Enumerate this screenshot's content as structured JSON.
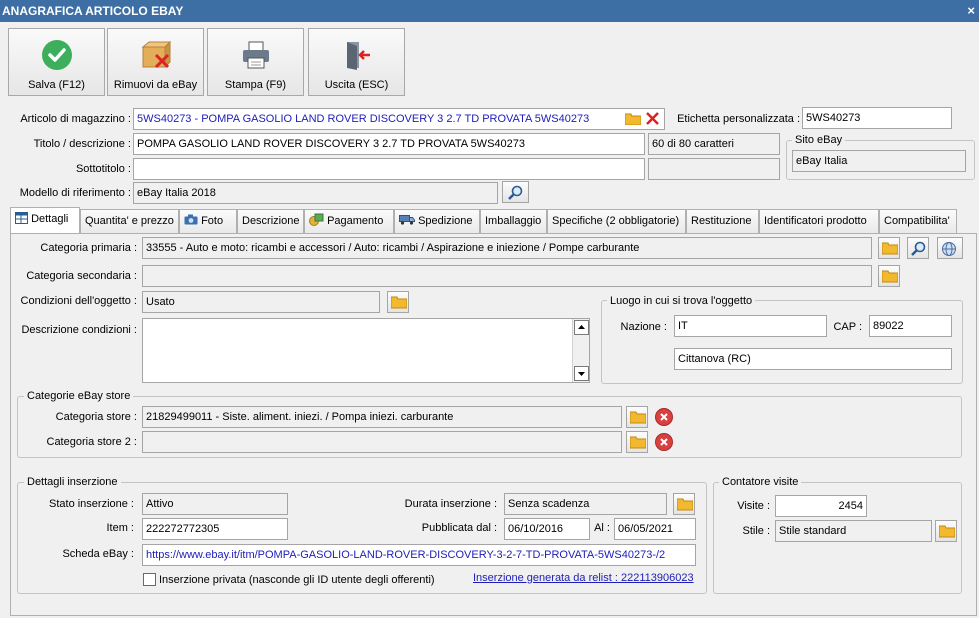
{
  "window": {
    "title": "ANAGRAFICA ARTICOLO EBAY",
    "close_glyph": "×"
  },
  "toolbar": {
    "save": "Salva (F12)",
    "remove": "Rimuovi da eBay",
    "print": "Stampa (F9)",
    "exit": "Uscita (ESC)"
  },
  "header": {
    "articolo_label": "Articolo di magazzino :",
    "articolo_value": "5WS40273 - POMPA GASOLIO LAND ROVER DISCOVERY 3 2.7 TD PROVATA 5WS40273",
    "etichetta_label": "Etichetta personalizzata :",
    "etichetta_value": "5WS40273",
    "titolo_label": "Titolo / descrizione :",
    "titolo_value": "POMPA GASOLIO LAND ROVER DISCOVERY 3 2.7 TD PROVATA 5WS40273",
    "titolo_count": "60 di 80 caratteri",
    "sottotitolo_label": "Sottotitolo :",
    "sottotitolo_value": "",
    "sito_title": "Sito eBay",
    "sito_value": "eBay Italia",
    "modello_label": "Modello di riferimento :",
    "modello_value": "eBay Italia 2018"
  },
  "tabs": [
    {
      "label": "Dettagli",
      "icon": "grid-icon"
    },
    {
      "label": "Quantita' e prezzo"
    },
    {
      "label": "Foto",
      "icon": "camera-icon"
    },
    {
      "label": "Descrizione"
    },
    {
      "label": "Pagamento",
      "icon": "payment-icon"
    },
    {
      "label": "Spedizione",
      "icon": "truck-icon"
    },
    {
      "label": "Imballaggio"
    },
    {
      "label": "Specifiche (2 obbligatorie)"
    },
    {
      "label": "Restituzione"
    },
    {
      "label": "Identificatori prodotto"
    },
    {
      "label": "Compatibilita'"
    }
  ],
  "details": {
    "cat_primaria_label": "Categoria primaria :",
    "cat_primaria_value": "33555 - Auto e moto: ricambi e accessori / Auto: ricambi / Aspirazione e iniezione / Pompe carburante",
    "cat_secondaria_label": "Categoria secondaria :",
    "cat_secondaria_value": "",
    "condizioni_label": "Condizioni dell'oggetto :",
    "condizioni_value": "Usato",
    "desc_cond_label": "Descrizione condizioni :",
    "desc_cond_value": "",
    "luogo_title": "Luogo in cui si trova l'oggetto",
    "nazione_label": "Nazione :",
    "nazione_value": "IT",
    "cap_label": "CAP :",
    "cap_value": "89022",
    "citta_value": "Cittanova (RC)",
    "store_title": "Categorie eBay store",
    "store1_label": "Categoria store :",
    "store1_value": "21829499011 - Siste. aliment. iniezi. / Pompa iniezi. carburante",
    "store2_label": "Categoria store 2 :",
    "store2_value": ""
  },
  "inserzione": {
    "title": "Dettagli inserzione",
    "stato_label": "Stato inserzione :",
    "stato_value": "Attivo",
    "durata_label": "Durata inserzione :",
    "durata_value": "Senza scadenza",
    "item_label": "Item :",
    "item_value": "222272772305",
    "pubblicata_label": "Pubblicata dal :",
    "pubblicata_value": "06/10/2016",
    "al_label": "Al :",
    "al_value": "06/05/2021",
    "scheda_label": "Scheda eBay :",
    "scheda_value": "https://www.ebay.it/itm/POMPA-GASOLIO-LAND-ROVER-DISCOVERY-3-2-7-TD-PROVATA-5WS40273-/2",
    "privata_label": "Inserzione privata (nasconde gli ID utente degli offerenti)",
    "relist_link": "Inserzione generata da relist : 222113906023"
  },
  "contatore": {
    "title": "Contatore visite",
    "visite_label": "Visite :",
    "visite_value": "2454",
    "stile_label": "Stile :",
    "stile_value": "Stile standard"
  },
  "colors": {
    "titlebar": "#3d6fa5",
    "link": "#1d1db8",
    "folder": "#f2b92e",
    "remove_red": "#d94040"
  }
}
